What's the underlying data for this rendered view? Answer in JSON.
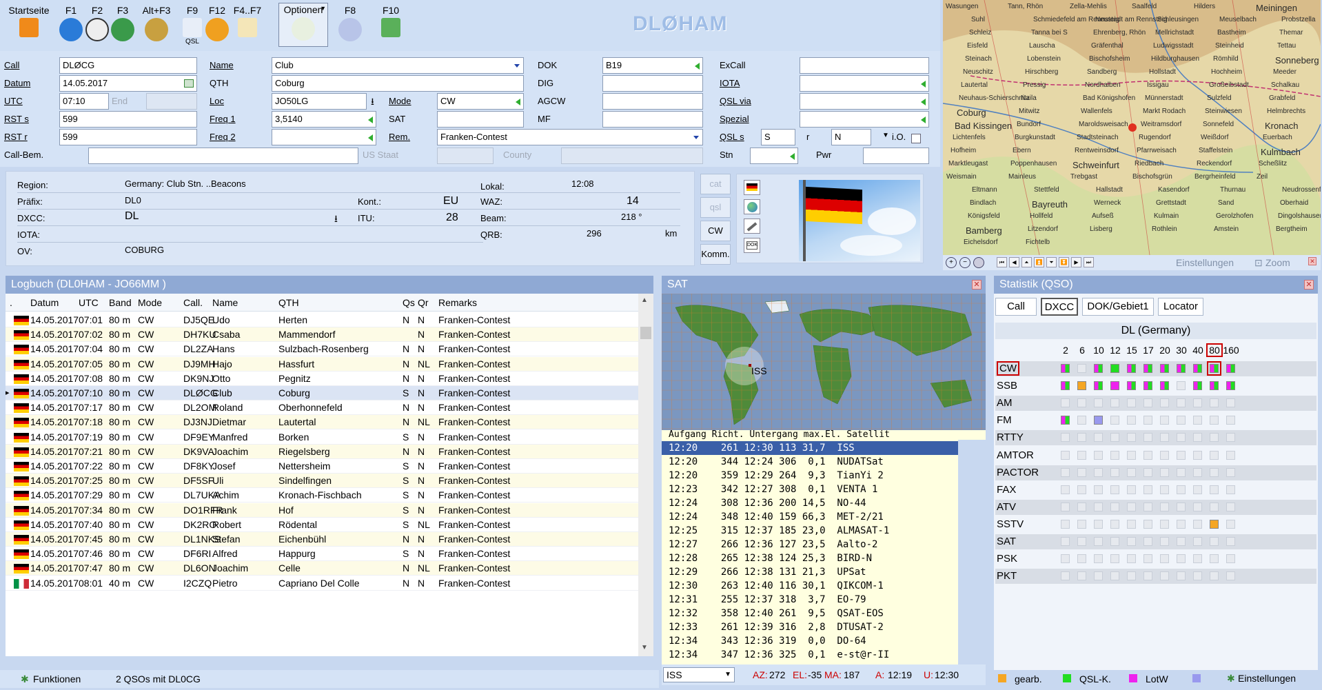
{
  "toolbar": {
    "buttons": [
      {
        "key": "Startseite",
        "icon": "home-icon"
      },
      {
        "key": "F1",
        "icon": "help-icon"
      },
      {
        "key": "F2",
        "icon": "clock-icon"
      },
      {
        "key": "F3",
        "icon": "globe-icon"
      },
      {
        "key": "Alt+F3",
        "icon": "satellite-icon"
      },
      {
        "key": "F9",
        "icon": "qsl-icon",
        "sub": "QSL"
      },
      {
        "key": "F12",
        "icon": "refresh-icon"
      },
      {
        "key": "F4..F7",
        "icon": "notepad-icon"
      },
      {
        "key": "Optionen",
        "icon": "tools-icon"
      },
      {
        "key": "F8",
        "icon": "cd-icon"
      },
      {
        "key": "F10",
        "icon": "save-icon"
      }
    ],
    "app_name": "DLØHAM"
  },
  "form": {
    "call_label": "Call",
    "call": "DLØCG",
    "datum_label": "Datum",
    "datum": "14.05.2017",
    "utc_label": "UTC",
    "utc": "07:10",
    "end_label": "End",
    "rsts_label": "RST s",
    "rsts": "599",
    "rstr_label": "RST r",
    "rstr": "599",
    "callbem_label": "Call-Bem.",
    "name_label": "Name",
    "name": "Club",
    "qth_label": "QTH",
    "qth": "Coburg",
    "loc_label": "Loc",
    "loc": "JO50LG",
    "mode_label": "Mode",
    "mode": "CW",
    "freq1_label": "Freq 1",
    "freq1": "3,5140",
    "sat_label": "SAT",
    "freq2_label": "Freq 2",
    "rem_label": "Rem.",
    "rem": "Franken-Contest",
    "usstaat_label": "US Staat",
    "county_label": "County",
    "dok_label": "DOK",
    "dok": "B19",
    "dig_label": "DIG",
    "agcw_label": "AGCW",
    "mf_label": "MF",
    "excall_label": "ExCall",
    "iota_label": "IOTA",
    "qslvia_label": "QSL via",
    "spezial_label": "Spezial",
    "qsls_label": "QSL s",
    "qsls": "S",
    "qslr_label": "r",
    "qslr": "N",
    "io_label": "i.O.",
    "stn_label": "Stn",
    "pwr_label": "Pwr"
  },
  "info": {
    "region_label": "Region:",
    "region": "Germany: Club Stn. ..Beacons",
    "prefix_label": "Präfix:",
    "prefix": "DL0",
    "dxcc_label": "DXCC:",
    "dxcc": "DL",
    "iota_label": "IOTA:",
    "ov_label": "OV:",
    "ov": "COBURG",
    "kont_label": "Kont.:",
    "kont": "EU",
    "itu_label": "ITU:",
    "itu": "28",
    "lokal_label": "Lokal:",
    "lokal": "12:08",
    "waz_label": "WAZ:",
    "waz": "14",
    "beam_label": "Beam:",
    "beam": "218 °",
    "qrb_label": "QRB:",
    "qrb": "296",
    "qrb_unit": "km",
    "side_buttons": [
      "cat",
      "qsl",
      "CW",
      "Komm."
    ]
  },
  "map": {
    "places": [
      "Wasungen",
      "Tann, Rhön",
      "Zella-Mehlis",
      "Saalfeld",
      "Hilders",
      "Meiningen",
      "Suhl",
      "Schmiedefeld am Rennsteig",
      "Neustadt am Rennsteig",
      "Schleusingen",
      "Meuselbach",
      "Probstzella",
      "Schleiz",
      "Tanna bei S",
      "Ehrenberg, Rhön",
      "Mellrichstadt",
      "Bastheim",
      "Themar",
      "Eisfeld",
      "Lauscha",
      "Gräfenthal",
      "Ludwigsstadt",
      "Steinheid",
      "Tettau",
      "Steinach",
      "Lobenstein",
      "Bischofsheim",
      "Hildburghausen",
      "Römhild",
      "Sonneberg",
      "Neuschitz",
      "Hirschberg",
      "Sandberg",
      "Hollstadt",
      "Hochheim",
      "Meeder",
      "Lautertal",
      "Pressig",
      "Nordhalben",
      "Issigau",
      "Großeibstadt",
      "Schalkau",
      "Neuhaus-Schierschnitz",
      "Naila",
      "Bad Königshofen",
      "Münnerstadt",
      "Sulzfeld",
      "Grabfeld",
      "Coburg",
      "Mitwitz",
      "Wallenfels",
      "Markt Rodach",
      "Steinwiesen",
      "Helmbrechts",
      "Bad Kissingen",
      "Bundorf",
      "Maroldsweisach",
      "Weitramsdorf",
      "Sonnefeld",
      "Kronach",
      "Lichtenfels",
      "Burgkunstadt",
      "Stadtsteinach",
      "Rugendorf",
      "Weißdorf",
      "Euerbach",
      "Hofheim",
      "Ebern",
      "Rentweinsdorf",
      "Pfarrweisach",
      "Staffelstein",
      "Kulmbach",
      "Marktleugast",
      "Poppenhausen",
      "Schweinfurt",
      "Riedbach",
      "Reckendorf",
      "Scheßlitz",
      "Weismain",
      "Mainleus",
      "Trebgast",
      "Bischofsgrün",
      "Bergrheinfeld",
      "Zeil",
      "Eltmann",
      "Stettfeld",
      "Hallstadt",
      "Kasendorf",
      "Thurnau",
      "Neudrossenfeld",
      "Bindlach",
      "Bayreuth",
      "Werneck",
      "Grettstadt",
      "Sand",
      "Oberhaid",
      "Königsfeld",
      "Hollfeld",
      "Aufseß",
      "Kulmain",
      "Gerolzhofen",
      "Dingolshausen",
      "Bamberg",
      "Litzendorf",
      "Lisberg",
      "Rothlein",
      "Amstein",
      "Bergtheim",
      "Eichelsdorf",
      "Fichtelb"
    ],
    "controls_label": "Einstellungen",
    "zoom_label": "Zoom"
  },
  "log": {
    "title": "Logbuch  (DL0HAM - JO66MM )",
    "columns": [
      ".",
      "Datum",
      "UTC",
      "Band",
      "Mode",
      "Call.",
      "Name",
      "QTH",
      "Qs",
      "Qr",
      "Remarks"
    ],
    "selected_index": 5,
    "rows": [
      {
        "flag": "de",
        "datum": "14.05.2017",
        "utc": "07:01",
        "band": "80 m",
        "mode": "CW",
        "call": "DJ5QE",
        "name": "Udo",
        "qth": "Herten",
        "qs": "N",
        "qr": "N",
        "rem": "Franken-Contest"
      },
      {
        "flag": "de",
        "datum": "14.05.2017",
        "utc": "07:02",
        "band": "80 m",
        "mode": "CW",
        "call": "DH7KU",
        "name": "Csaba",
        "qth": "Mammendorf",
        "qs": "",
        "qr": "N",
        "rem": "Franken-Contest"
      },
      {
        "flag": "de",
        "datum": "14.05.2017",
        "utc": "07:04",
        "band": "80 m",
        "mode": "CW",
        "call": "DL2ZA",
        "name": "Hans",
        "qth": "Sulzbach-Rosenberg",
        "qs": "N",
        "qr": "N",
        "rem": "Franken-Contest"
      },
      {
        "flag": "de",
        "datum": "14.05.2017",
        "utc": "07:05",
        "band": "80 m",
        "mode": "CW",
        "call": "DJ9MH",
        "name": "Hajo",
        "qth": "Hassfurt",
        "qs": "N",
        "qr": "NL",
        "rem": "Franken-Contest"
      },
      {
        "flag": "de",
        "datum": "14.05.2017",
        "utc": "07:08",
        "band": "80 m",
        "mode": "CW",
        "call": "DK9NJ",
        "name": "Otto",
        "qth": "Pegnitz",
        "qs": "N",
        "qr": "N",
        "rem": "Franken-Contest"
      },
      {
        "flag": "de",
        "datum": "14.05.2017",
        "utc": "07:10",
        "band": "80 m",
        "mode": "CW",
        "call": "DLØCG",
        "name": "Club",
        "qth": "Coburg",
        "qs": "S",
        "qr": "N",
        "rem": "Franken-Contest"
      },
      {
        "flag": "de",
        "datum": "14.05.2017",
        "utc": "07:17",
        "band": "80 m",
        "mode": "CW",
        "call": "DL2OM",
        "name": "Roland",
        "qth": "Oberhonnefeld",
        "qs": "N",
        "qr": "N",
        "rem": "Franken-Contest"
      },
      {
        "flag": "de",
        "datum": "14.05.2017",
        "utc": "07:18",
        "band": "80 m",
        "mode": "CW",
        "call": "DJ3NJ",
        "name": "Dietmar",
        "qth": "Lautertal",
        "qs": "N",
        "qr": "NL",
        "rem": "Franken-Contest"
      },
      {
        "flag": "de",
        "datum": "14.05.2017",
        "utc": "07:19",
        "band": "80 m",
        "mode": "CW",
        "call": "DF9EY",
        "name": "Manfred",
        "qth": "Borken",
        "qs": "S",
        "qr": "N",
        "rem": "Franken-Contest"
      },
      {
        "flag": "de",
        "datum": "14.05.2017",
        "utc": "07:21",
        "band": "80 m",
        "mode": "CW",
        "call": "DK9VA",
        "name": "Joachim",
        "qth": "Riegelsberg",
        "qs": "N",
        "qr": "N",
        "rem": "Franken-Contest"
      },
      {
        "flag": "de",
        "datum": "14.05.2017",
        "utc": "07:22",
        "band": "80 m",
        "mode": "CW",
        "call": "DF8KY",
        "name": "Josef",
        "qth": "Nettersheim",
        "qs": "S",
        "qr": "N",
        "rem": "Franken-Contest"
      },
      {
        "flag": "de",
        "datum": "14.05.2017",
        "utc": "07:25",
        "band": "80 m",
        "mode": "CW",
        "call": "DF5SF",
        "name": "Uli",
        "qth": "Sindelfingen",
        "qs": "S",
        "qr": "N",
        "rem": "Franken-Contest"
      },
      {
        "flag": "de",
        "datum": "14.05.2017",
        "utc": "07:29",
        "band": "80 m",
        "mode": "CW",
        "call": "DL7UKA",
        "name": "Achim",
        "qth": "Kronach-Fischbach",
        "qs": "S",
        "qr": "N",
        "rem": "Franken-Contest"
      },
      {
        "flag": "de",
        "datum": "14.05.2017",
        "utc": "07:34",
        "band": "80 m",
        "mode": "CW",
        "call": "DO1RFR",
        "name": "Frank",
        "qth": "Hof",
        "qs": "S",
        "qr": "N",
        "rem": "Franken-Contest"
      },
      {
        "flag": "de",
        "datum": "14.05.2017",
        "utc": "07:40",
        "band": "80 m",
        "mode": "CW",
        "call": "DK2RO",
        "name": "Robert",
        "qth": "Rödental",
        "qs": "S",
        "qr": "NL",
        "rem": "Franken-Contest"
      },
      {
        "flag": "de",
        "datum": "14.05.2017",
        "utc": "07:45",
        "band": "80 m",
        "mode": "CW",
        "call": "DL1NKS",
        "name": "Stefan",
        "qth": "Eichenbühl",
        "qs": "N",
        "qr": "N",
        "rem": "Franken-Contest"
      },
      {
        "flag": "de",
        "datum": "14.05.2017",
        "utc": "07:46",
        "band": "80 m",
        "mode": "CW",
        "call": "DF6RI",
        "name": "Alfred",
        "qth": "Happurg",
        "qs": "S",
        "qr": "N",
        "rem": "Franken-Contest"
      },
      {
        "flag": "de",
        "datum": "14.05.2017",
        "utc": "07:47",
        "band": "80 m",
        "mode": "CW",
        "call": "DL6ON",
        "name": "Joachim",
        "qth": "Celle",
        "qs": "N",
        "qr": "NL",
        "rem": "Franken-Contest"
      },
      {
        "flag": "it",
        "datum": "14.05.2017",
        "utc": "08:01",
        "band": "40 m",
        "mode": "CW",
        "call": "I2CZQ",
        "name": "Pietro",
        "qth": "Capriano Del Colle",
        "qs": "N",
        "qr": "N",
        "rem": "Franken-Contest"
      }
    ],
    "footer_func": "Funktionen",
    "footer_count": "2 QSOs mit DL0CG"
  },
  "sat": {
    "title": "SAT",
    "map_label": "ISS",
    "header": "Aufgang Richt. Untergang max.El. Satellit",
    "rows": [
      "12:20    261 12:30 113 31,7  ISS",
      "12:20    344 12:24 306  0,1  NUDATSat",
      "12:20    359 12:29 264  9,3  TianYi 2",
      "12:23    342 12:27 308  0,1  VENTA 1",
      "12:24    308 12:36 200 14,5  NO-44",
      "12:24    348 12:40 159 66,3  MET-2/21",
      "12:25    315 12:37 185 23,0  ALMASAT-1",
      "12:27    266 12:36 127 23,5  Aalto-2",
      "12:28    265 12:38 124 25,3  BIRD-N",
      "12:29    266 12:38 131 21,3  UPSat",
      "12:30    263 12:40 116 30,1  QIKCOM-1",
      "12:31    255 12:37 318  3,7  EO-79",
      "12:32    358 12:40 261  9,5  QSAT-EOS",
      "12:33    261 12:39 316  2,8  DTUSAT-2",
      "12:34    343 12:36 319  0,0  DO-64",
      "12:34    347 12:36 325  0,1  e-st@r-II"
    ],
    "select": "ISS",
    "az_label": "AZ:",
    "az": "272",
    "el_label": "EL:",
    "el": "-35",
    "ma_label": "MA:",
    "ma": "187",
    "a_label": "A:",
    "a": "12:19",
    "u_label": "U:",
    "u": "12:30"
  },
  "stat": {
    "title": "Statistik (QSO)",
    "tabs": [
      "Call",
      "DXCC",
      "DOK/Gebiet1",
      "Locator"
    ],
    "heading": "DL (Germany)",
    "bands": [
      "2",
      "6",
      "10",
      "12",
      "15",
      "17",
      "20",
      "30",
      "40",
      "80",
      "160"
    ],
    "modes": [
      "CW",
      "SSB",
      "AM",
      "FM",
      "RTTY",
      "AMTOR",
      "PACTOR",
      "FAX",
      "ATV",
      "SSTV",
      "SAT",
      "PSK",
      "PKT"
    ],
    "legend": [
      {
        "label": "gearb.",
        "color": "#f5a623"
      },
      {
        "label": "QSL-K.",
        "color": "#22dd22"
      },
      {
        "label": "LotW",
        "color": "#ee22ee"
      },
      {
        "label": "",
        "color": "#9999ee"
      }
    ],
    "settings": "Einstellungen"
  }
}
